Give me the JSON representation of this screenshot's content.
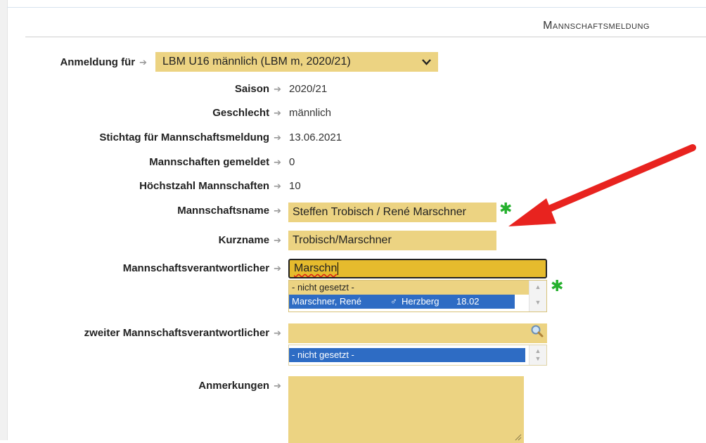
{
  "header": {
    "title": "Mannschaftsmeldung"
  },
  "arrow_glyph": "➔",
  "form": {
    "anmeldung": {
      "label": "Anmeldung für",
      "value": "LBM U16 männlich (LBM m, 2020/21)"
    },
    "saison": {
      "label": "Saison",
      "value": "2020/21"
    },
    "geschlecht": {
      "label": "Geschlecht",
      "value": "männlich"
    },
    "stichtag": {
      "label": "Stichtag für Mannschaftsmeldung",
      "value": "13.06.2021"
    },
    "gemeldet": {
      "label": "Mannschaften gemeldet",
      "value": "0"
    },
    "hoechstzahl": {
      "label": "Höchstzahl Mannschaften",
      "value": "10"
    },
    "mannschaftsname": {
      "label": "Mannschaftsname",
      "value": "Steffen Trobisch / René Marschner"
    },
    "kurzname": {
      "label": "Kurzname",
      "value": "Trobisch/Marschner"
    },
    "verantwortlicher": {
      "label": "Mannschaftsverantwortlicher",
      "input": "Marschn",
      "options": [
        {
          "text": "- nicht gesetzt -"
        },
        {
          "name": "Marschner, René",
          "gender": "♂",
          "place": "Herzberg",
          "date": "18.02"
        }
      ]
    },
    "zweiter": {
      "label": "zweiter Mannschaftsverantwortlicher",
      "input": "",
      "options": [
        {
          "text": "- nicht gesetzt -"
        }
      ]
    },
    "anmerkungen": {
      "label": "Anmerkungen",
      "value": ""
    }
  },
  "colors": {
    "field": "#ecd382",
    "focused": "#e6bb2d",
    "selected": "#2e6cc4",
    "required": "#25b02d",
    "annotation_arrow": "#e8231f"
  },
  "icons": [
    "dropdown-chevron-icon",
    "required-star-icon",
    "magnifier-icon",
    "resize-grip-icon",
    "annotation-arrow-icon"
  ]
}
